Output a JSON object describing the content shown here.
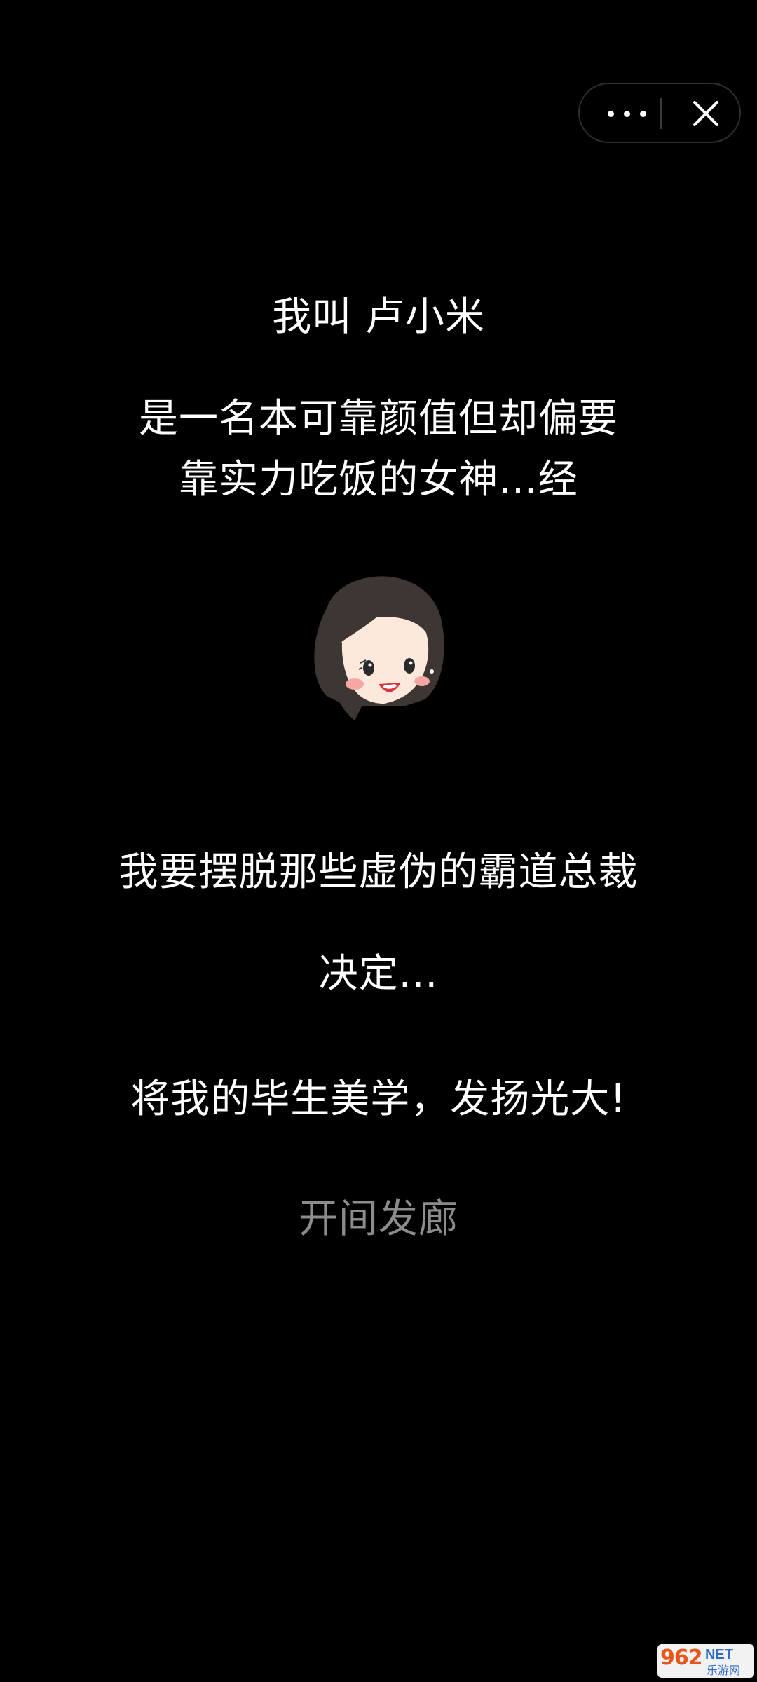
{
  "capsule": {
    "more_icon": "more-dots-icon",
    "close_icon": "close-icon"
  },
  "intro": {
    "line1": "我叫 卢小米",
    "line2": "是一名本可靠颜值但却偏要",
    "line3": "靠实力吃饭的女神...经"
  },
  "avatar": {
    "icon": "girl-avatar-illustration"
  },
  "story": {
    "line1": "我要摆脱那些虚伪的霸道总裁",
    "line2": "决定...",
    "line3": "将我的毕生美学，发扬光大!"
  },
  "action": {
    "label": "开间发廊"
  },
  "watermark": {
    "number": "962",
    "net": "NET",
    "sub": "乐游网"
  },
  "colors": {
    "background": "#000000",
    "text": "#ffffff",
    "muted_text": "#8c8c8c"
  }
}
